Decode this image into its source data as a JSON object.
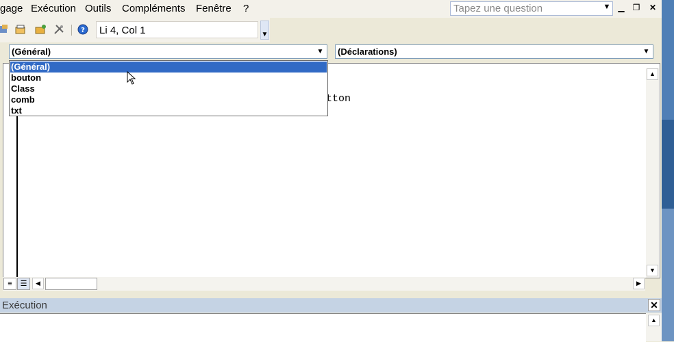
{
  "menu": {
    "items": [
      {
        "label": "gage"
      },
      {
        "label": "Exécution"
      },
      {
        "label": "Outils"
      },
      {
        "label": "Compléments"
      },
      {
        "label": "Fenêtre"
      },
      {
        "label": "?"
      }
    ],
    "ask_placeholder": "Tapez une question"
  },
  "toolbar": {
    "position_text": "Li 4, Col 1"
  },
  "code_window": {
    "object_combo": "(Général)",
    "procedure_combo": "(Déclarations)",
    "code_fragment": "utton",
    "object_list": [
      {
        "label": "(Général)",
        "selected": true
      },
      {
        "label": "bouton",
        "selected": false
      },
      {
        "label": "Class",
        "selected": false
      },
      {
        "label": "comb",
        "selected": false
      },
      {
        "label": "txt",
        "selected": false
      }
    ]
  },
  "exec_pane": {
    "title": "Exécution"
  },
  "colors": {
    "selection": "#316ac5",
    "title_bar": "#c5d3e4"
  }
}
